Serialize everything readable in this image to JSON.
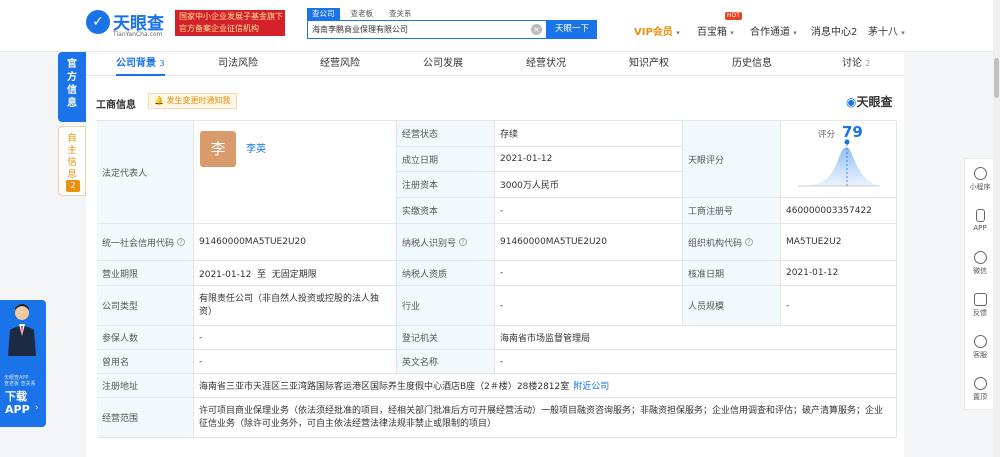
{
  "header": {
    "logo_name": "天眼查",
    "logo_sub": "TianYanCha.com",
    "badge_line1": "国家中小企业发展子基金旗下",
    "badge_line2": "官方备案企业征信机构",
    "search_tabs": [
      "查公司",
      "查老板",
      "查关系"
    ],
    "search_value": "海南李鹏商业保理有限公司",
    "search_button": "天眼一下",
    "nav": {
      "vip": "VIP会员",
      "baibao": "百宝箱",
      "hot": "HOT",
      "hezuo": "合作通道",
      "message": "消息中心2",
      "user": "茅十八"
    }
  },
  "side_tabs": {
    "official": "官方信息",
    "self": "自主信息",
    "self_count": "2"
  },
  "tabs": [
    {
      "label": "公司背景",
      "count": "3"
    },
    {
      "label": "司法风险",
      "count": ""
    },
    {
      "label": "经营风险",
      "count": ""
    },
    {
      "label": "公司发展",
      "count": ""
    },
    {
      "label": "经营状况",
      "count": ""
    },
    {
      "label": "知识产权",
      "count": ""
    },
    {
      "label": "历史信息",
      "count": ""
    },
    {
      "label": "讨论",
      "count": "2"
    }
  ],
  "section": {
    "title": "工商信息",
    "notice": "发生变更时通知我",
    "logo": "天眼查"
  },
  "info": {
    "legal_rep_label": "法定代表人",
    "avatar_char": "李",
    "legal_rep_name": "李英",
    "status_label": "经营状态",
    "status_value": "存续",
    "found_label": "成立日期",
    "found_value": "2021-01-12",
    "capital_label": "注册资本",
    "capital_value": "3000万人民币",
    "paid_label": "实缴资本",
    "paid_value": "-",
    "score_label": "天眼评分",
    "score_title": "评分",
    "score_value": "79",
    "regno_label": "工商注册号",
    "regno_value": "460000003357422",
    "credit_label": "统一社会信用代码",
    "credit_value": "91460000MA5TUE2U20",
    "taxno_label": "纳税人识别号",
    "taxno_value": "91460000MA5TUE2U20",
    "orgcode_label": "组织机构代码",
    "orgcode_value": "MA5TUE2U2",
    "term_label": "营业期限",
    "term_value": "2021-01-12  至  无固定期限",
    "taxq_label": "纳税人资质",
    "taxq_value": "-",
    "approve_label": "核准日期",
    "approve_value": "2021-01-12",
    "type_label": "公司类型",
    "type_value": "有限责任公司（非自然人投资或控股的法人独资）",
    "industry_label": "行业",
    "industry_value": "-",
    "staff_label": "人员规模",
    "staff_value": "-",
    "insured_label": "参保人数",
    "insured_value": "-",
    "authority_label": "登记机关",
    "authority_value": "海南省市场监督管理局",
    "former_label": "曾用名",
    "former_value": "-",
    "english_label": "英文名称",
    "english_value": "-",
    "address_label": "注册地址",
    "address_value": "海南省三亚市天涯区三亚湾路国际客运港区国际养生度假中心酒店B座（2＃楼）28楼2812室",
    "nearby": "附近公司",
    "scope_label": "经营范围",
    "scope_value": "许可项目商业保理业务（依法须经批准的项目，经相关部门批准后方可开展经营活动）一般项目融资咨询服务；非融资担保服务；企业信用调查和评估；破产清算服务；企业征信业务（除许可业务外，可自主依法经营法律法规非禁止或限制的项目）"
  },
  "right_bar": [
    "小程序",
    "APP",
    "微信",
    "反馈",
    "客服",
    "置顶"
  ],
  "promo": {
    "small1": "天眼查APP",
    "small2": "查老板 查关系",
    "download": "下载",
    "app": "APP"
  },
  "colors": {
    "brand": "#1a73e8",
    "label_bg": "#f2f9fc",
    "warn": "#e8910c"
  }
}
